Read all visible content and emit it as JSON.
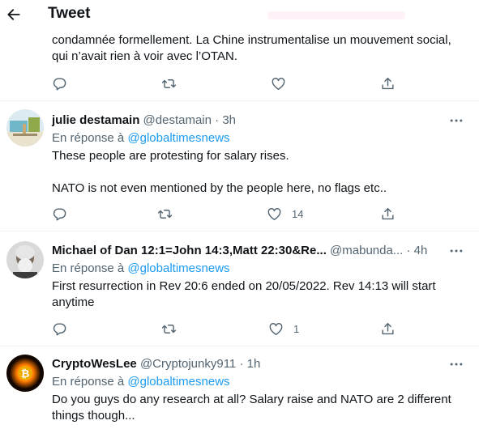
{
  "header": {
    "title": "Tweet",
    "back_icon": "arrow-left-icon"
  },
  "colors": {
    "link": "#1d9bf0",
    "secondary_text": "#536471",
    "divider": "#eff3f4"
  },
  "top_tweet": {
    "text_line1": "condamnée formellement. La Chine instrumentalise un mouvement social,",
    "text_line2": "qui n’avait rien à voir avec l’OTAN."
  },
  "replies": [
    {
      "name": "julie destamain",
      "handle": "@destamain",
      "time": "· 3h",
      "reply_prefix": "En réponse à",
      "reply_to": "@globaltimesnews",
      "text_line1": "These people are protesting for salary rises.",
      "text_line2": "NATO is not even mentioned by the people here, no flags etc..",
      "like_count": "14"
    },
    {
      "name": "Michael of Dan 12:1=John 14:3,Matt 22:30&Re...",
      "handle": "@mabunda...",
      "time": "· 4h",
      "reply_prefix": "En réponse à",
      "reply_to": "@globaltimesnews",
      "text_line1": "First resurrection in Rev 20:6 ended on 20/05/2022. Rev 14:13 will start",
      "text_line2": "anytime",
      "like_count": "1"
    },
    {
      "name": "CryptoWesLee",
      "handle": "@Cryptojunky911",
      "time": "· 1h",
      "reply_prefix": "En réponse à",
      "reply_to": "@globaltimesnews",
      "text_line1": "Do you guys do any research at all? Salary raise and NATO are 2 different",
      "text_line2": "things though..."
    }
  ],
  "icons": {
    "reply": "reply-icon",
    "retweet": "retweet-icon",
    "like": "like-icon",
    "share": "share-icon",
    "more": "more-icon"
  }
}
